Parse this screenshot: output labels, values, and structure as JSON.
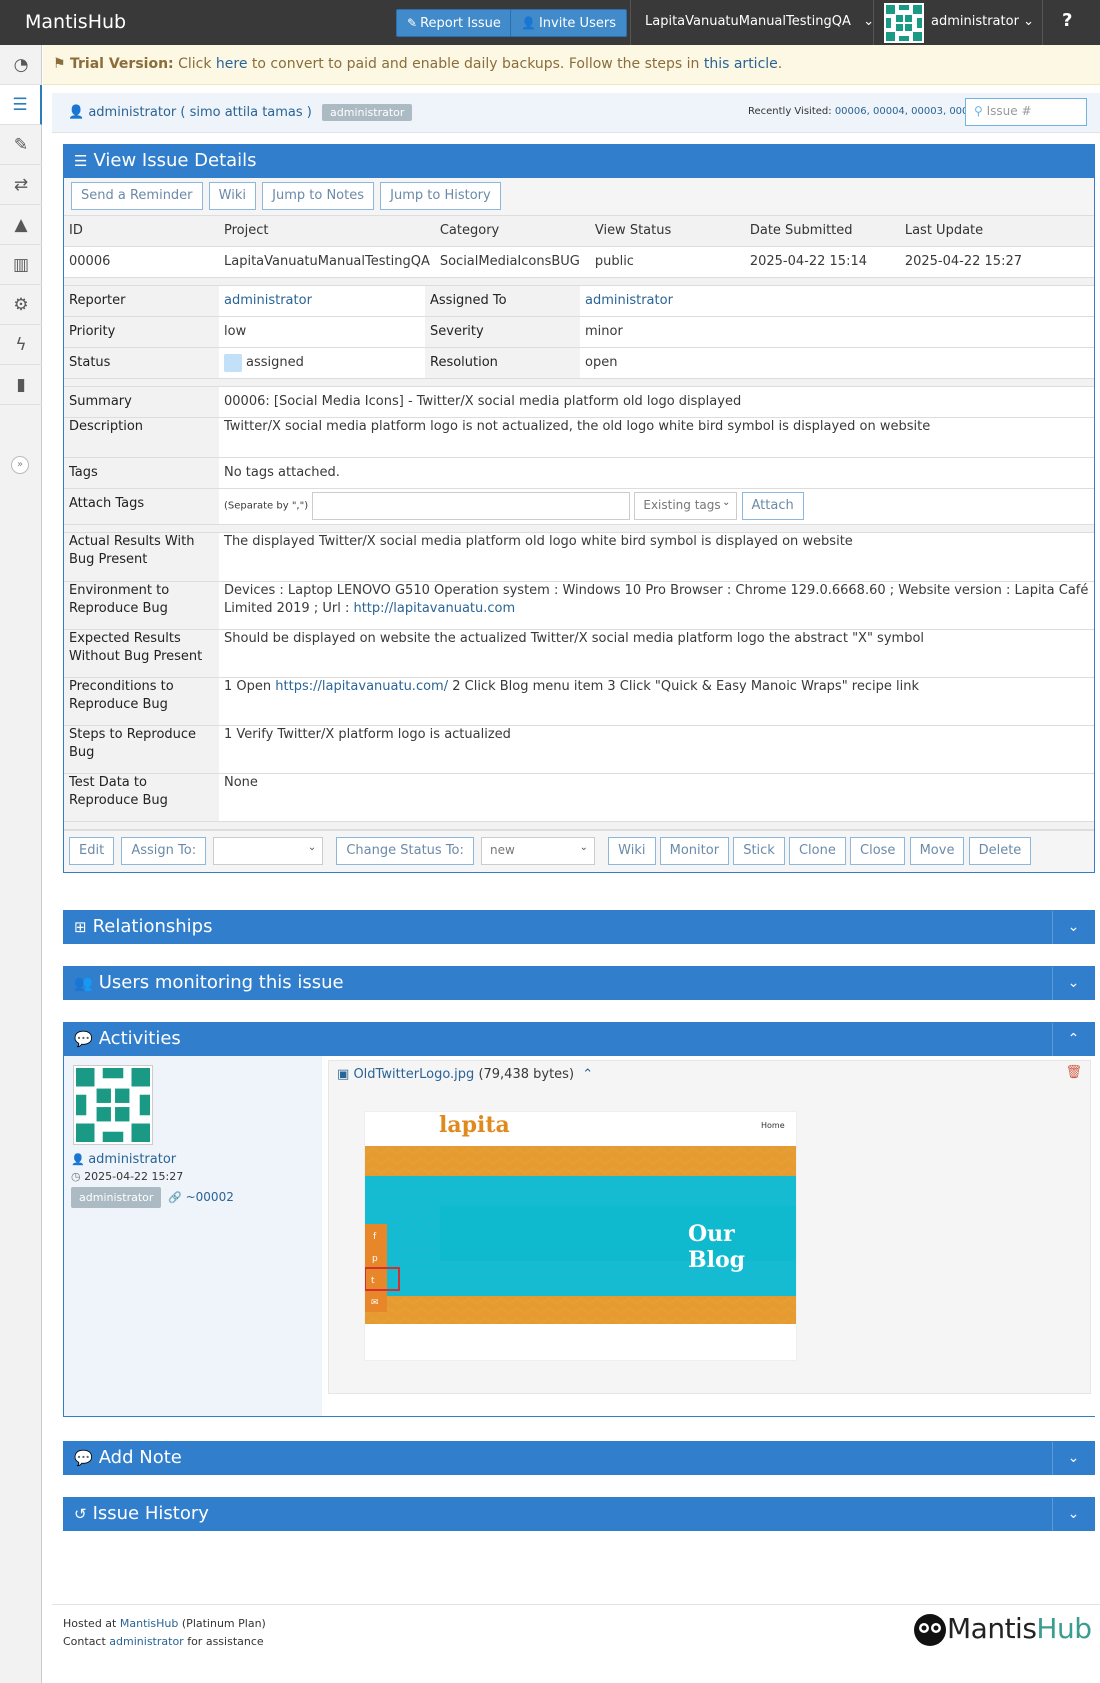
{
  "navbar": {
    "brand": "MantisHub",
    "report_issue": "Report Issue",
    "invite_users": "Invite Users",
    "project": "LapitaVanuatuManualTestingQA",
    "user": "administrator",
    "help": "?"
  },
  "alert": {
    "label": "Trial Version:",
    "text1": "Click",
    "here": "here",
    "text2": "to convert to paid and enable daily backups. Follow the steps in",
    "article": "this article",
    "text3": "."
  },
  "crumbs": {
    "user": "administrator ( simo attila tamas )",
    "role": "administrator",
    "recent_label": "Recently Visited:",
    "recent": "00006, 00004, 00003, 00005",
    "search_placeholder": "Issue #"
  },
  "details": {
    "title": "View Issue Details",
    "buttons": [
      "Send a Reminder",
      "Wiki",
      "Jump to Notes",
      "Jump to History"
    ],
    "headers": [
      "ID",
      "Project",
      "Category",
      "View Status",
      "Date Submitted",
      "Last Update"
    ],
    "values": [
      "00006",
      "LapitaVanuatuManualTestingQA",
      "SocialMediaIconsBUG",
      "public",
      "2025-04-22 15:14",
      "2025-04-22 15:27"
    ],
    "reporter_label": "Reporter",
    "reporter": "administrator",
    "assigned_label": "Assigned To",
    "assigned": "administrator",
    "priority_label": "Priority",
    "priority": "low",
    "severity_label": "Severity",
    "severity": "minor",
    "status_label": "Status",
    "status": "assigned",
    "resolution_label": "Resolution",
    "resolution": "open",
    "summary_label": "Summary",
    "summary": "00006: [Social Media Icons] - Twitter/X social media platform old logo displayed",
    "description_label": "Description",
    "description": "Twitter/X social media platform logo is not actualized, the old logo white bird symbol is displayed on website",
    "tags_label": "Tags",
    "tags": "No tags attached.",
    "attach_label": "Attach Tags",
    "attach_hint": "(Separate by \",\")",
    "existing_tags": "Existing tags",
    "attach_btn": "Attach",
    "actual_label": "Actual Results With Bug Present",
    "actual": "The displayed Twitter/X social media platform old logo white bird symbol is displayed on website",
    "env_label": "Environment to Reproduce Bug",
    "env": "Devices : Laptop LENOVO G510 Operation system : Windows 10 Pro Browser : Chrome 129.0.6668.60 ; Website version : Lapita Café Limited 2019 ; Url :",
    "env_url": "http://lapitavanuatu.com",
    "expected_label": "Expected Results Without Bug Present",
    "expected": "Should be displayed on website the actualized Twitter/X social media platform logo the abstract \"X\" symbol",
    "pre_label": "Preconditions to Reproduce Bug",
    "pre_1": "1 Open",
    "pre_url": "https://lapitavanuatu.com/",
    "pre_2": "2 Click Blog menu item 3 Click \"Quick & Easy Manoic Wraps\" recipe link",
    "steps_label": "Steps to Reproduce Bug",
    "steps": "1 Verify Twitter/X platform logo is actualized",
    "test_label": "Test Data to Reproduce Bug",
    "test": "None",
    "act_edit": "Edit",
    "act_assign": "Assign To:",
    "act_change": "Change Status To:",
    "act_status_value": "new",
    "act_buttons": [
      "Wiki",
      "Monitor",
      "Stick",
      "Clone",
      "Close",
      "Move",
      "Delete"
    ]
  },
  "sections": {
    "relationships": "Relationships",
    "monitoring": "Users monitoring this issue",
    "activities": "Activities",
    "add_note": "Add Note",
    "history": "Issue History"
  },
  "activity": {
    "user": "administrator",
    "date": "2025-04-22 15:27",
    "role": "administrator",
    "note_id": "~00002",
    "file": "OldTwitterLogo.jpg",
    "size": "(79,438 bytes)",
    "shot_logo": "lapita",
    "shot_nav": "Home",
    "shot_title": "Our Blog"
  },
  "footer": {
    "hosted": "Hosted at",
    "mantishub": "MantisHub",
    "plan": "(Platinum Plan)",
    "contact": "Contact",
    "admin": "administrator",
    "assist": "for assistance",
    "logo_a": "Mantis",
    "logo_b": "Hub"
  },
  "colors": {
    "navbar": "#393939",
    "accent": "#307ecc",
    "status_assigned": "#c2e0f7",
    "alert_bg": "#fcf8e3"
  }
}
